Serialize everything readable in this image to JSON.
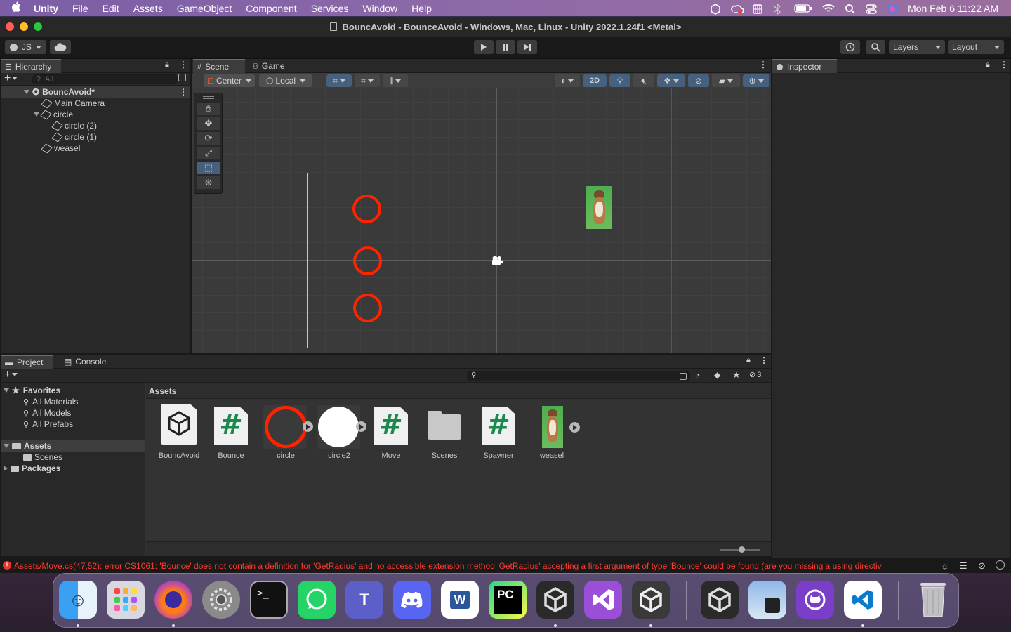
{
  "menubar": {
    "apple": "",
    "app": "Unity",
    "items": [
      "File",
      "Edit",
      "Assets",
      "GameObject",
      "Component",
      "Services",
      "Window",
      "Help"
    ],
    "clock": "Mon Feb 6  11:22 AM"
  },
  "window": {
    "title": "BouncAvoid - BounceAvoid - Windows, Mac, Linux - Unity 2022.1.24f1 <Metal>"
  },
  "toolbar": {
    "account": "JS",
    "layers": "Layers",
    "layout": "Layout"
  },
  "hierarchy": {
    "tab": "Hierarchy",
    "search_placeholder": "All",
    "scene": "BouncAvoid*",
    "items": [
      "Main Camera",
      "circle",
      "circle (2)",
      "circle (1)",
      "weasel"
    ]
  },
  "scene": {
    "tabs": [
      "Scene",
      "Game"
    ],
    "pivot": "Center",
    "space": "Local",
    "mode_2d": "2D"
  },
  "inspector": {
    "tab": "Inspector"
  },
  "project": {
    "tabs": [
      "Project",
      "Console"
    ],
    "favorites": "Favorites",
    "fav_items": [
      "All Materials",
      "All Models",
      "All Prefabs"
    ],
    "assets": "Assets",
    "scenes": "Scenes",
    "packages": "Packages",
    "breadcrumb": "Assets",
    "hidden_count": "3",
    "grid": [
      "BouncAvoid",
      "Bounce",
      "circle",
      "circle2",
      "Move",
      "Scenes",
      "Spawner",
      "weasel"
    ]
  },
  "status": {
    "error": "Assets/Move.cs(47,52): error CS1061: 'Bounce' does not contain a definition for 'GetRadius' and no accessible extension method 'GetRadius' accepting a first argument of type 'Bounce' could be found (are you missing a using directiv"
  },
  "colors": {
    "accent": "#3a79bb",
    "error": "#ff3b30",
    "circle": "#ff2200"
  }
}
